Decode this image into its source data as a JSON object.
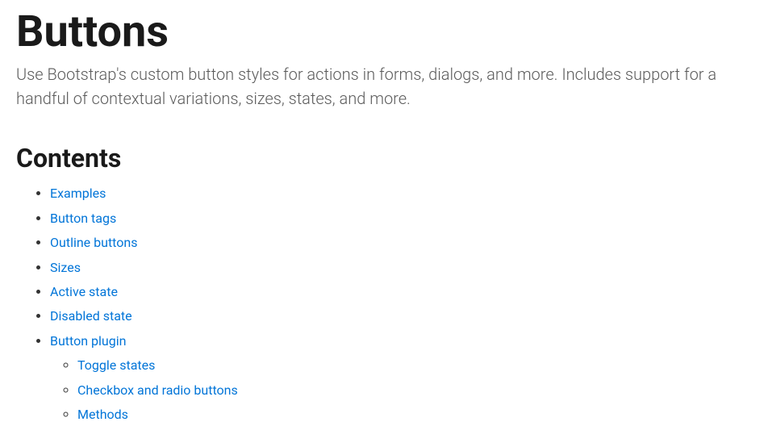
{
  "page": {
    "title": "Buttons",
    "lead": "Use Bootstrap's custom button styles for actions in forms, dialogs, and more. Includes support for a handful of contextual variations, sizes, states, and more."
  },
  "contents": {
    "heading": "Contents",
    "items": [
      "Examples",
      "Button tags",
      "Outline buttons",
      "Sizes",
      "Active state",
      "Disabled state",
      "Button plugin"
    ],
    "subitems": [
      "Toggle states",
      "Checkbox and radio buttons",
      "Methods"
    ]
  }
}
